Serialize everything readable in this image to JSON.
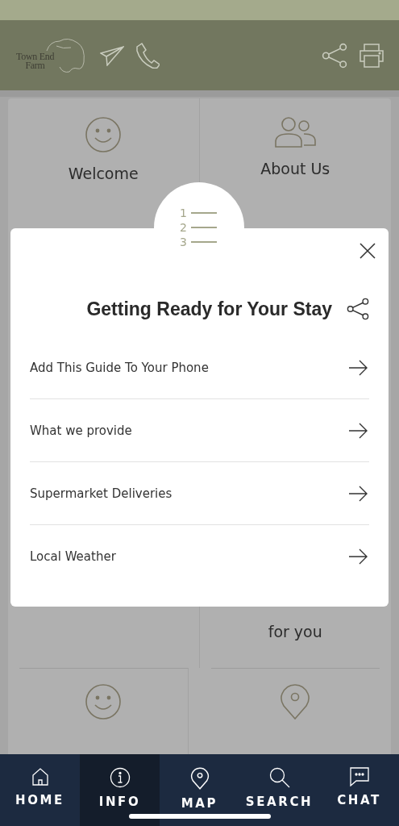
{
  "header": {
    "logo_lines": [
      "Town End",
      "Farm"
    ]
  },
  "tiles": [
    {
      "kind": "smiley",
      "label": "Welcome"
    },
    {
      "kind": "people",
      "label": "About Us"
    },
    {
      "kind": "blank"
    },
    {
      "kind": "blank",
      "label": "for you"
    },
    {
      "kind": "smiley"
    },
    {
      "kind": "pin"
    }
  ],
  "modal": {
    "icon_numbers": [
      "1",
      "2",
      "3"
    ],
    "title": "Getting Ready for Your Stay",
    "items": [
      {
        "label": "Add This Guide To Your Phone"
      },
      {
        "label": "What we provide"
      },
      {
        "label": "Supermarket Deliveries"
      },
      {
        "label": "Local Weather"
      }
    ]
  },
  "nav": [
    {
      "kind": "home",
      "label": "HOME",
      "selected": false
    },
    {
      "kind": "info",
      "label": "INFO",
      "selected": true
    },
    {
      "kind": "pin",
      "label": "MAP",
      "selected": false
    },
    {
      "kind": "search",
      "label": "SEARCH",
      "selected": false
    },
    {
      "kind": "chat",
      "label": "CHAT",
      "selected": false
    }
  ]
}
